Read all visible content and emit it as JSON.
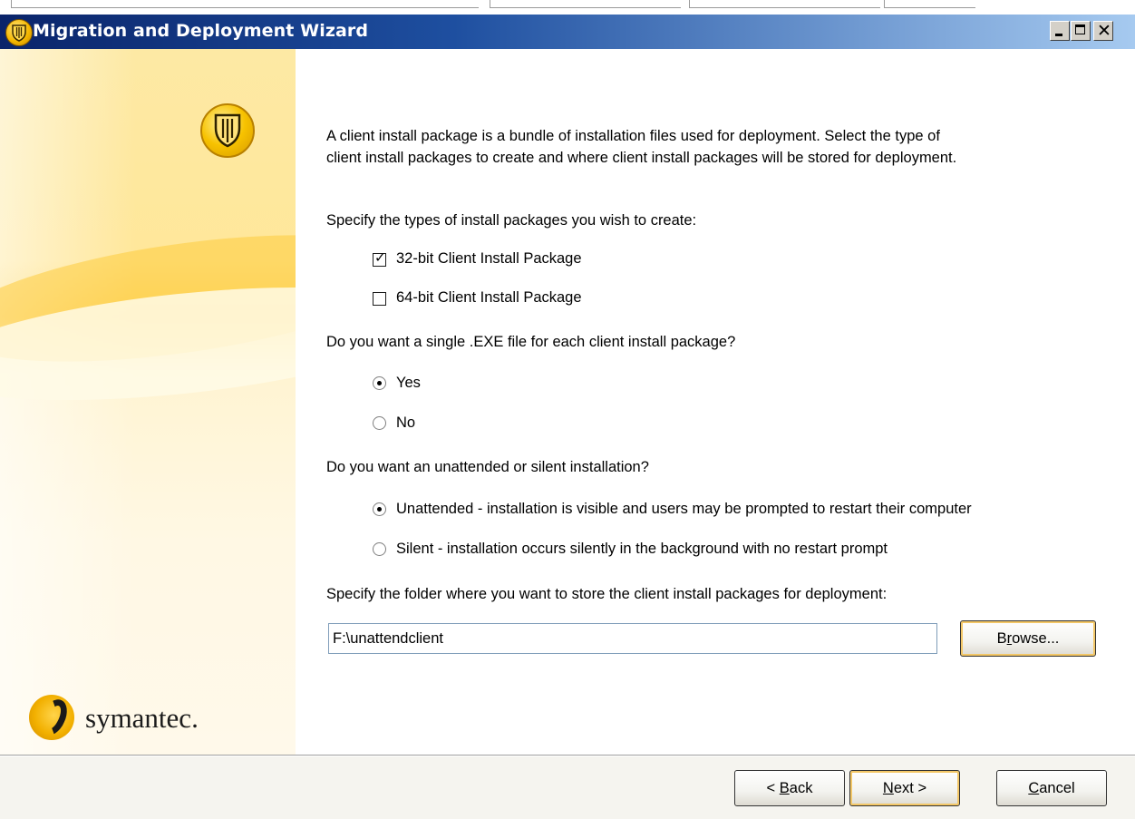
{
  "window": {
    "title": "Migration and Deployment Wizard"
  },
  "banner": {
    "brand": "symantec."
  },
  "content": {
    "intro_line1": "A client install package is a bundle of installation files used for deployment. Select the type of",
    "intro_line2": "client install packages to create and where client install packages will be stored for deployment.",
    "types_prompt": "Specify the types of install packages you wish to create:",
    "package_types": [
      {
        "label": "32-bit Client Install Package",
        "checked": true
      },
      {
        "label": "64-bit Client Install Package",
        "checked": false
      }
    ],
    "single_exe_prompt": "Do you want a single .EXE file for each client install package?",
    "single_exe_options": [
      {
        "label": "Yes",
        "selected": true
      },
      {
        "label": "No",
        "selected": false
      }
    ],
    "install_mode_prompt": "Do you want an unattended or silent installation?",
    "install_mode_options": [
      {
        "label": "Unattended - installation is visible and users may be prompted to restart their computer",
        "selected": true
      },
      {
        "label": "Silent - installation occurs silently in the background with no restart prompt",
        "selected": false
      }
    ],
    "folder_prompt": "Specify the folder where you want to store the client install packages for deployment:",
    "folder_value": "F:\\unattendclient",
    "browse_label_pre": "B",
    "browse_label_u": "r",
    "browse_label_post": "owse..."
  },
  "footer": {
    "back_pre": "< ",
    "back_u": "B",
    "back_post": "ack",
    "next_u": "N",
    "next_post": "ext >",
    "cancel_u": "C",
    "cancel_post": "ancel"
  }
}
